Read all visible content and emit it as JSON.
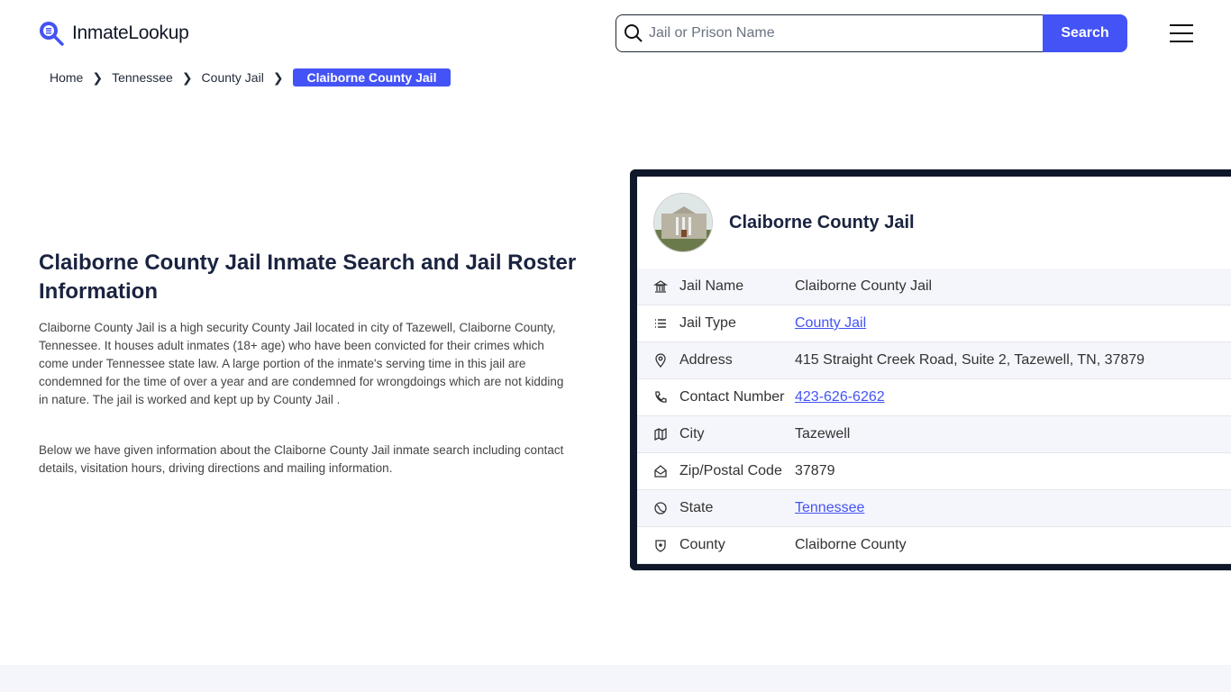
{
  "header": {
    "logo_text": "InmateLookup",
    "search_placeholder": "Jail or Prison Name",
    "search_label": "Search"
  },
  "breadcrumb": [
    "Home",
    "Tennessee",
    "County Jail",
    "Claiborne County Jail"
  ],
  "main": {
    "title": "Claiborne County Jail Inmate Search and Jail Roster Information",
    "paragraphs": [
      "Claiborne County Jail is a high security County Jail located in city of Tazewell, Claiborne County, Tennessee. It houses adult inmates (18+ age) who have been convicted for their crimes which come under Tennessee state law. A large portion of the inmate's serving time in this jail are condemned for the time of over a year and are condemned for wrongdoings which are not kidding in nature. The jail is worked and kept up by County Jail .",
      "Below we have given information about the Claiborne County Jail inmate search including contact details, visitation hours, driving directions and mailing information."
    ]
  },
  "card": {
    "title": "Claiborne County Jail",
    "rows": [
      {
        "icon": "bank-icon",
        "label": "Jail Name",
        "value": "Claiborne County Jail",
        "link": false
      },
      {
        "icon": "list-icon",
        "label": "Jail Type",
        "value": "County Jail",
        "link": true
      },
      {
        "icon": "map-pin-icon",
        "label": "Address",
        "value": "415 Straight Creek Road, Suite 2, Tazewell, TN, 37879",
        "link": false
      },
      {
        "icon": "phone-icon",
        "label": "Contact Number",
        "value": "423-626-6262",
        "link": true
      },
      {
        "icon": "map-icon",
        "label": "City",
        "value": "Tazewell",
        "link": false
      },
      {
        "icon": "mail-open-icon",
        "label": "Zip/Postal Code",
        "value": "37879",
        "link": false
      },
      {
        "icon": "globe-icon",
        "label": "State",
        "value": "Tennessee",
        "link": true
      },
      {
        "icon": "shield-icon",
        "label": "County",
        "value": "Claiborne County",
        "link": false
      }
    ]
  },
  "colors": {
    "accent": "#4353f5",
    "card_border": "#0f172a",
    "row_tint": "#f5f6fc"
  }
}
